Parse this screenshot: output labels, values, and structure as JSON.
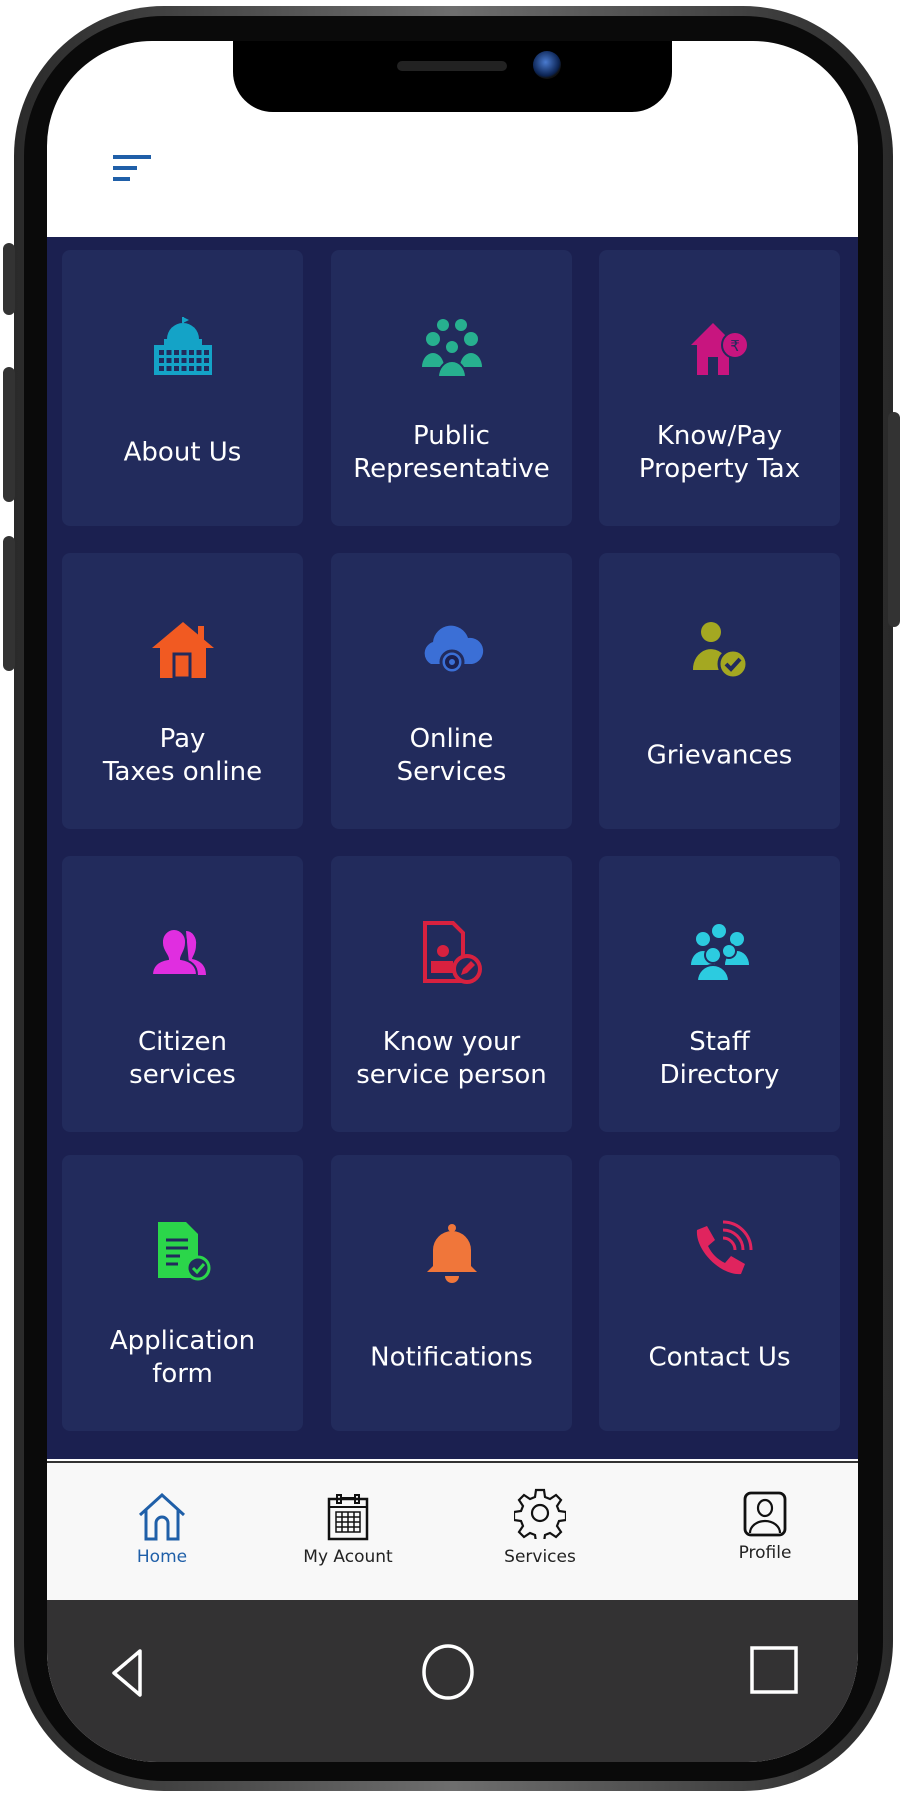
{
  "header": {
    "menu_icon": "menu-icon"
  },
  "colors": {
    "grid_bg": "#1b2050",
    "tile_bg": "#222b5c",
    "accent": "#1f5fa8"
  },
  "tiles": [
    {
      "label": "About Us",
      "icon": "capitol-building-icon",
      "color": "#14a3c7"
    },
    {
      "label": "Public\nRepresentative",
      "icon": "group-icon",
      "color": "#27b08f"
    },
    {
      "label": "Know/Pay\nProperty Tax",
      "icon": "house-rupee-icon",
      "color": "#c8157f"
    },
    {
      "label": "Pay\nTaxes online",
      "icon": "house-icon",
      "color": "#f15a22"
    },
    {
      "label": "Online\nServices",
      "icon": "cloud-gear-icon",
      "color": "#3b6fd6"
    },
    {
      "label": "Grievances",
      "icon": "user-check-icon",
      "color": "#a4a821"
    },
    {
      "label": "Citizen\nservices",
      "icon": "users-icon",
      "color": "#e02ee0"
    },
    {
      "label": "Know your\nservice person",
      "icon": "id-document-edit-icon",
      "color": "#d8213f"
    },
    {
      "label": "Staff\nDirectory",
      "icon": "staff-group-icon",
      "color": "#2ccbe0"
    },
    {
      "label": "Application\nform",
      "icon": "form-check-icon",
      "color": "#2bd64a"
    },
    {
      "label": "Notifications",
      "icon": "bell-icon",
      "color": "#f0763a"
    },
    {
      "label": "Contact Us",
      "icon": "phone-ringing-icon",
      "color": "#e0245e"
    }
  ],
  "bottom_nav": [
    {
      "label": "Home",
      "icon": "home-icon",
      "active": true
    },
    {
      "label": "My Acount",
      "icon": "calendar-icon",
      "active": false
    },
    {
      "label": "Services",
      "icon": "gear-icon",
      "active": false
    },
    {
      "label": "Profile",
      "icon": "profile-icon",
      "active": false
    }
  ],
  "system_nav": {
    "back": "back-icon",
    "home": "circle-home-icon",
    "recent": "recent-apps-icon"
  }
}
